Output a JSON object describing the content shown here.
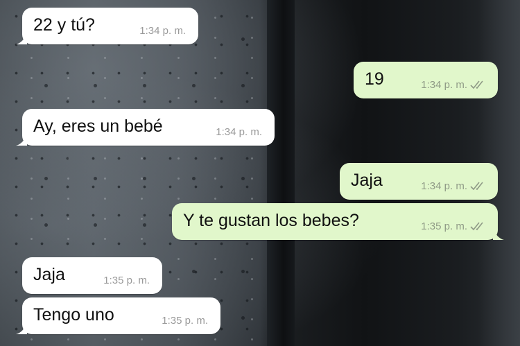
{
  "messages": [
    {
      "direction": "incoming",
      "text": "22 y tú?",
      "time": "1:34 p. m."
    },
    {
      "direction": "outgoing",
      "text": "19",
      "time": "1:34 p. m.",
      "status_icon": "double-check-icon"
    },
    {
      "direction": "incoming",
      "text": "Ay, eres un bebé",
      "time": "1:34 p. m."
    },
    {
      "direction": "outgoing",
      "text": "Jaja",
      "time": "1:34 p. m.",
      "status_icon": "double-check-icon"
    },
    {
      "direction": "outgoing",
      "text": "Y te gustan los bebes?",
      "time": "1:35 p. m.",
      "status_icon": "double-check-icon"
    },
    {
      "direction": "incoming",
      "text": "Jaja",
      "time": "1:35 p. m."
    },
    {
      "direction": "incoming",
      "text": "Tengo uno",
      "time": "1:35 p. m."
    }
  ],
  "colors": {
    "incoming_bubble": "#ffffff",
    "outgoing_bubble": "#e1f7cb",
    "timestamp": "#9a9a9a"
  }
}
